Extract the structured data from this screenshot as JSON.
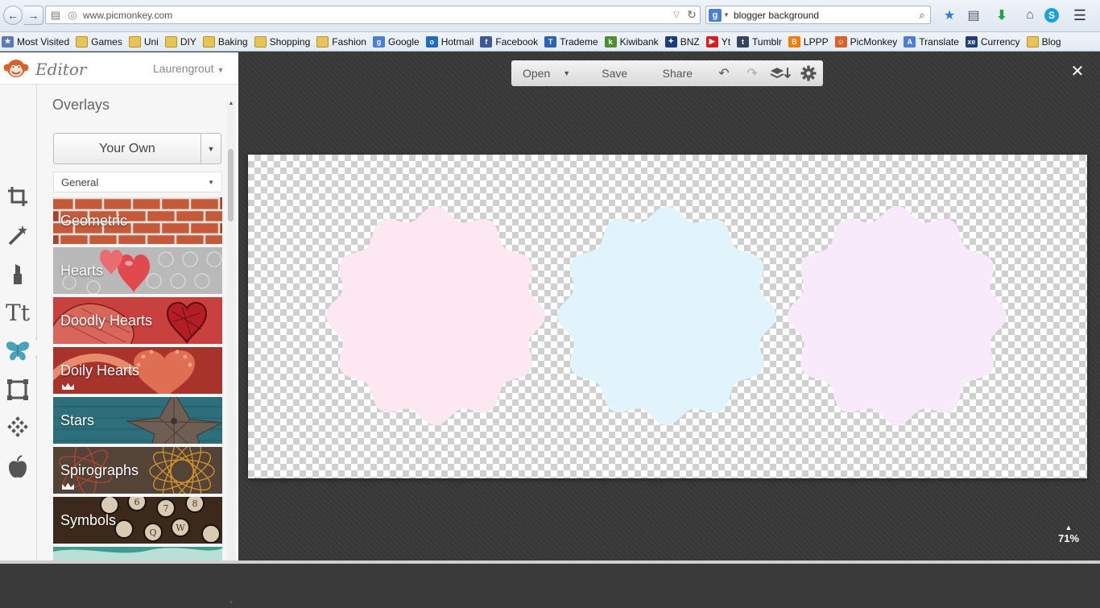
{
  "browser": {
    "url": "www.picmonkey.com",
    "search_query": "blogger background",
    "search_engine_letter": "g"
  },
  "bookmarks": [
    {
      "label": "Most Visited",
      "icon": "bookmarks-folder-icon",
      "color": "#5a7bb0"
    },
    {
      "label": "Games",
      "icon": "folder-icon",
      "color": "#e8c457"
    },
    {
      "label": "Uni",
      "icon": "folder-icon",
      "color": "#e8c457"
    },
    {
      "label": "DIY",
      "icon": "folder-icon",
      "color": "#e8c457"
    },
    {
      "label": "Baking",
      "icon": "folder-icon",
      "color": "#e8c457"
    },
    {
      "label": "Shopping",
      "icon": "folder-icon",
      "color": "#e8c457"
    },
    {
      "label": "Fashion",
      "icon": "folder-icon",
      "color": "#e8c457"
    },
    {
      "label": "Google",
      "icon": "google-icon",
      "color": "#4a7fd8"
    },
    {
      "label": "Hotmail",
      "icon": "outlook-icon",
      "color": "#1f6bbf"
    },
    {
      "label": "Facebook",
      "icon": "facebook-icon",
      "color": "#3b5998"
    },
    {
      "label": "Trademe",
      "icon": "trademe-icon",
      "color": "#2b63b5"
    },
    {
      "label": "Kiwibank",
      "icon": "kiwibank-icon",
      "color": "#4f8f2f"
    },
    {
      "label": "BNZ",
      "icon": "bnz-icon",
      "color": "#1d3d7a"
    },
    {
      "label": "Yt",
      "icon": "youtube-icon",
      "color": "#d61f1f"
    },
    {
      "label": "Tumblr",
      "icon": "tumblr-icon",
      "color": "#35465c"
    },
    {
      "label": "LPPP",
      "icon": "blogger-icon",
      "color": "#f57d00"
    },
    {
      "label": "PicMonkey",
      "icon": "picmonkey-icon",
      "color": "#d9622b"
    },
    {
      "label": "Translate",
      "icon": "translate-icon",
      "color": "#4a7fd8"
    },
    {
      "label": "Currency",
      "icon": "xe-icon",
      "color": "#1f3f7a"
    },
    {
      "label": "Blog",
      "icon": "folder-icon",
      "color": "#e8c457"
    }
  ],
  "app": {
    "editor_label": "Editor",
    "username": "Laurengrout"
  },
  "overlays": {
    "title": "Overlays",
    "your_own_label": "Your Own",
    "category": "General",
    "tiles": [
      {
        "label": "Geometric",
        "premium": false
      },
      {
        "label": "Hearts",
        "premium": false
      },
      {
        "label": "Doodly Hearts",
        "premium": false
      },
      {
        "label": "Doily Hearts",
        "premium": true
      },
      {
        "label": "Stars",
        "premium": false
      },
      {
        "label": "Spirographs",
        "premium": true
      },
      {
        "label": "Symbols",
        "premium": false
      }
    ]
  },
  "toolbar": {
    "open_label": "Open",
    "save_label": "Save",
    "share_label": "Share"
  },
  "canvas": {
    "badges": [
      {
        "name": "pink-badge",
        "color": "#fde8f2"
      },
      {
        "name": "blue-badge",
        "color": "#e2f4fb"
      },
      {
        "name": "lavender-badge",
        "color": "#f8e9fb"
      }
    ]
  },
  "zoom": {
    "level": "71%"
  },
  "colors": {
    "accent": "#d9622b",
    "workspace": "#393939"
  }
}
